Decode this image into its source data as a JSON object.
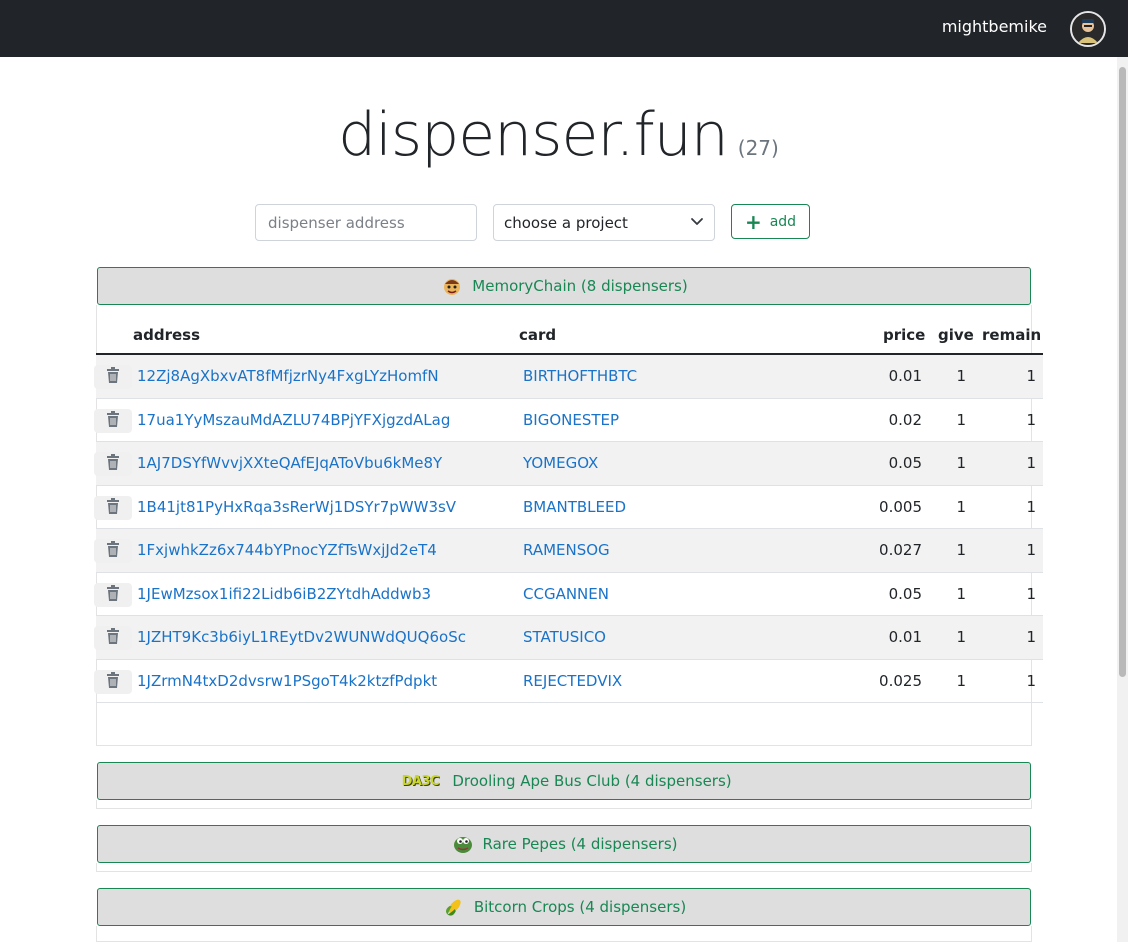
{
  "header": {
    "username": "mightbemike",
    "avatar_icon": "user-avatar-icon"
  },
  "title": {
    "text": "dispenser.fun",
    "count": "(27)"
  },
  "form": {
    "address_placeholder": "dispenser address",
    "project_select_value": "choose a project",
    "add_label": "add"
  },
  "table": {
    "columns": {
      "address": "address",
      "card": "card",
      "price": "price",
      "give": "give",
      "remain": "remain"
    }
  },
  "projects": [
    {
      "label": "MemoryChain (8 dispensers)",
      "icon": "memorychain-icon",
      "expanded": true,
      "rows": [
        {
          "address": "12Zj8AgXbxvAT8fMfjzrNy4FxgLYzHomfN",
          "card": "BIRTHOFTHBTC",
          "price": "0.01",
          "give": "1",
          "remain": "1"
        },
        {
          "address": "17ua1YyMszauMdAZLU74BPjYFXjgzdALag",
          "card": "BIGONESTEP",
          "price": "0.02",
          "give": "1",
          "remain": "1"
        },
        {
          "address": "1AJ7DSYfWvvjXXteQAfEJqAToVbu6kMe8Y",
          "card": "YOMEGOX",
          "price": "0.05",
          "give": "1",
          "remain": "1"
        },
        {
          "address": "1B41jt81PyHxRqa3sRerWj1DSYr7pWW3sV",
          "card": "BMANTBLEED",
          "price": "0.005",
          "give": "1",
          "remain": "1"
        },
        {
          "address": "1FxjwhkZz6x744bYPnocYZfTsWxjJd2eT4",
          "card": "RAMENSOG",
          "price": "0.027",
          "give": "1",
          "remain": "1"
        },
        {
          "address": "1JEwMzsox1ifi22Lidb6iB2ZYtdhAddwb3",
          "card": "CCGANNEN",
          "price": "0.05",
          "give": "1",
          "remain": "1"
        },
        {
          "address": "1JZHT9Kc3b6iyL1REytDv2WUNWdQUQ6oSc",
          "card": "STATUSICO",
          "price": "0.01",
          "give": "1",
          "remain": "1"
        },
        {
          "address": "1JZrmN4txD2dvsrw1PSgoT4k2ktzfPdpkt",
          "card": "REJECTEDVIX",
          "price": "0.025",
          "give": "1",
          "remain": "1"
        }
      ]
    },
    {
      "label": "Drooling Ape Bus Club (4 dispensers)",
      "icon": "dabc-logo-icon",
      "icon_text": "DA3C",
      "expanded": false
    },
    {
      "label": "Rare Pepes (4 dispensers)",
      "icon": "pepe-icon",
      "expanded": false
    },
    {
      "label": "Bitcorn Crops (4 dispensers)",
      "icon": "corn-icon",
      "expanded": false
    }
  ],
  "colors": {
    "navbar": "#212529",
    "accent_green": "#198754",
    "link_blue": "#1a73c8"
  }
}
